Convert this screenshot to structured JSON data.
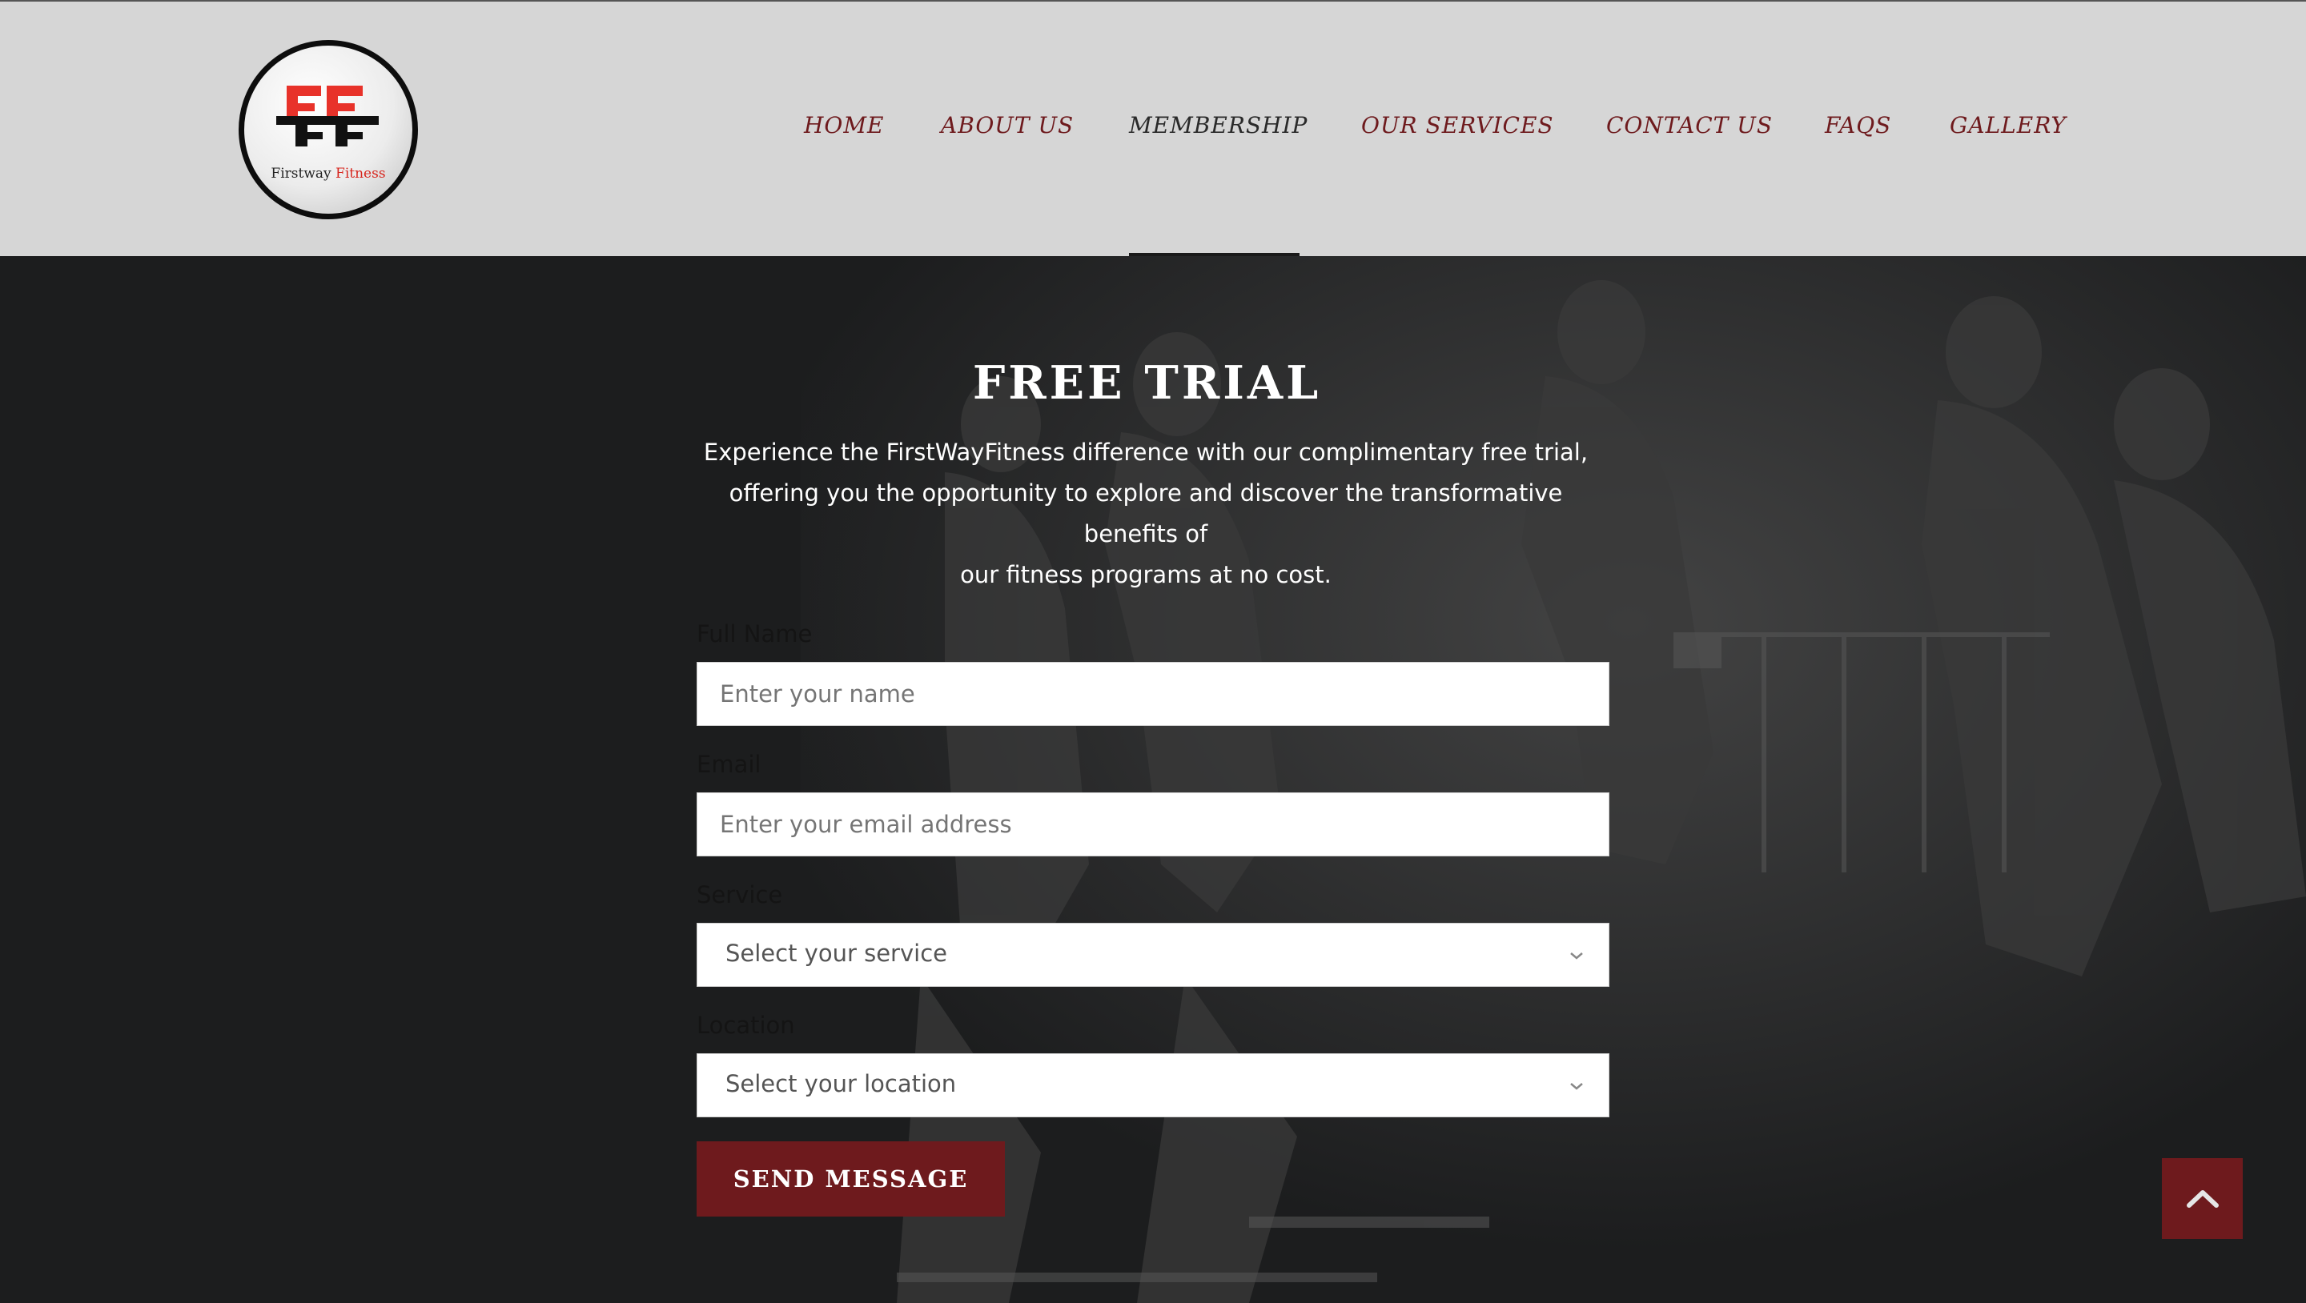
{
  "brand": {
    "logo_initials": "FF",
    "name_part1": "Firstway",
    "name_part2": "Fitness",
    "accent_color": "#d7261e"
  },
  "nav": {
    "items": [
      {
        "label": "HOME",
        "active": false
      },
      {
        "label": "ABOUT US",
        "active": false
      },
      {
        "label": "MEMBERSHIP",
        "active": true
      },
      {
        "label": "OUR SERVICES",
        "active": false
      },
      {
        "label": "CONTACT US",
        "active": false
      },
      {
        "label": "FAQS",
        "active": false
      },
      {
        "label": "GALLERY",
        "active": false
      }
    ],
    "color": "#6e1a1d",
    "active_color": "#2a2a2a"
  },
  "hero": {
    "title": "FREE TRIAL",
    "description_lines": [
      "Experience the FirstWayFitness difference with our complimentary free trial,",
      "offering you the opportunity to explore and discover the transformative benefits of",
      "our fitness programs at no cost."
    ]
  },
  "form": {
    "name": {
      "label": "Full Name",
      "placeholder": "Enter your name",
      "value": ""
    },
    "email": {
      "label": "Email",
      "placeholder": "Enter your email address",
      "value": ""
    },
    "service": {
      "label": "Service",
      "selected": "Select your service"
    },
    "location": {
      "label": "Location",
      "selected": "Select your location"
    },
    "submit_label": "SEND MESSAGE"
  },
  "scroll_top_icon": "chevron-up-icon",
  "colors": {
    "header_bg": "#d6d6d6",
    "page_bg": "#1c1d1e",
    "button_bg": "#6e1a1d"
  }
}
